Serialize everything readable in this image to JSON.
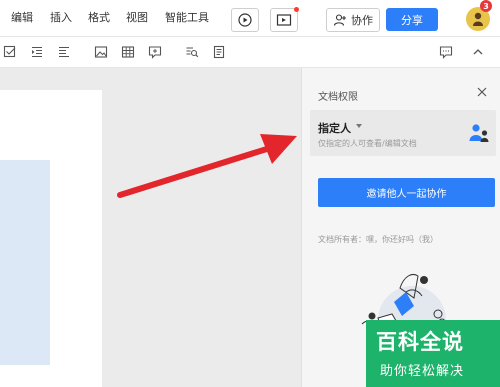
{
  "menu": {
    "items": [
      "编辑",
      "插入",
      "格式",
      "视图",
      "智能工具"
    ],
    "collab_label": "协作",
    "share_label": "分享",
    "notification_count": "3"
  },
  "toolbar": {
    "icons": [
      "checkbox-icon",
      "indent-icon",
      "outdent-icon",
      "image-icon",
      "table-icon",
      "comment-box-icon",
      "find-icon",
      "document-icon",
      "comment-icon",
      "collapse-icon"
    ]
  },
  "panel": {
    "title": "文档权限",
    "permission_label": "指定人",
    "permission_desc": "仅指定的人可查看/编辑文档",
    "invite_label": "邀请他人一起协作",
    "owner_text": "文档所有者：嘿，你还好吗（我）"
  },
  "watermark": {
    "title": "百科全说",
    "subtitle": "助你轻松解决"
  },
  "colors": {
    "accent": "#2d7ff9",
    "arrow": "#e3262b",
    "watermark": "#1db36b"
  }
}
